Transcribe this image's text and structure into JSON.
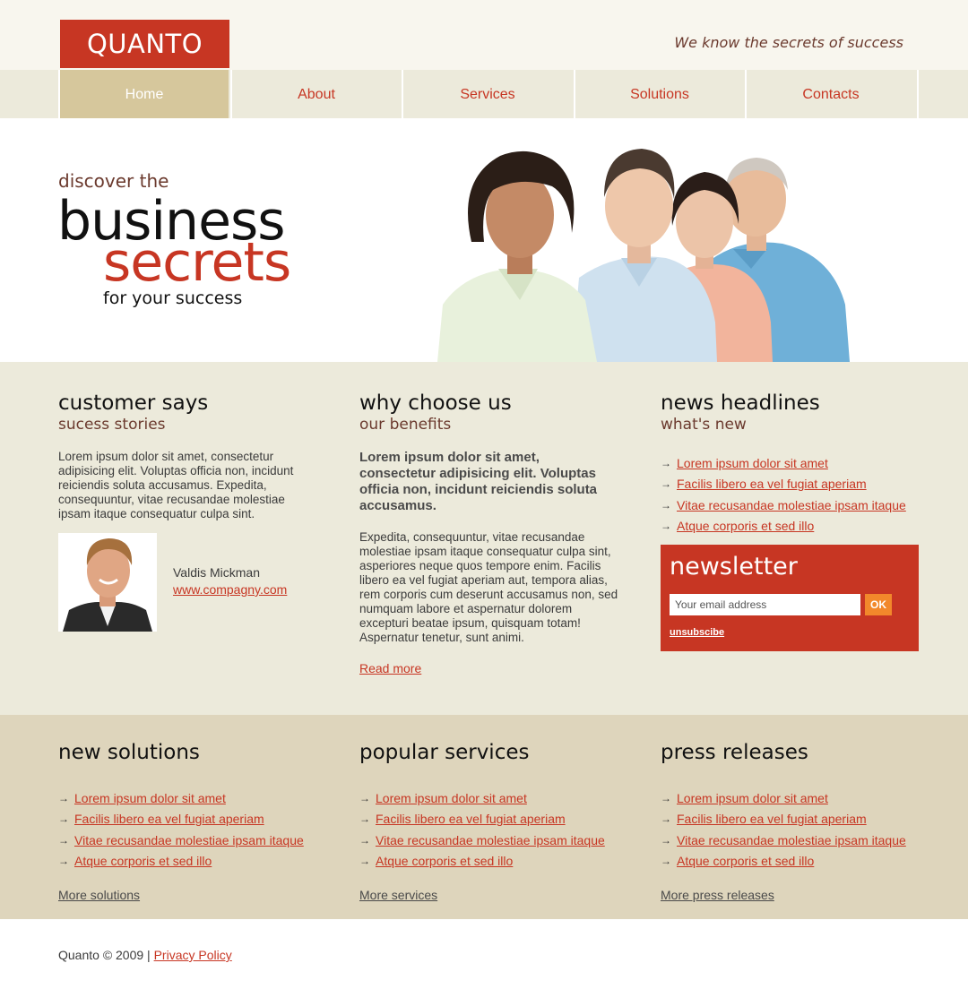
{
  "header": {
    "logo": "QUANTO",
    "tagline": "We know the secrets of success"
  },
  "nav": {
    "items": [
      {
        "label": "Home",
        "active": true
      },
      {
        "label": "About",
        "active": false
      },
      {
        "label": "Services",
        "active": false
      },
      {
        "label": "Solutions",
        "active": false
      },
      {
        "label": "Contacts",
        "active": false
      }
    ]
  },
  "hero": {
    "discover": "discover the",
    "business": "business",
    "secrets": "secrets",
    "success": "for your success"
  },
  "customer": {
    "title": "customer says",
    "subtitle": "sucess stories",
    "text": "Lorem ipsum dolor sit amet, consectetur adipisicing elit. Voluptas officia non, incidunt reiciendis soluta accusamus. Expedita, consequuntur, vitae recusandae molestiae ipsam itaque consequatur culpa sint.",
    "name": "Valdis Mickman",
    "website": "www.compagny.com"
  },
  "why": {
    "title": "why choose us",
    "subtitle": "our benefits",
    "bold_text": "Lorem ipsum dolor sit amet, consectetur adipisicing elit. Voluptas officia non, incidunt reiciendis soluta accusamus.",
    "text": "Expedita, consequuntur, vitae recusandae molestiae ipsam itaque consequatur culpa sint, asperiores neque quos tempore enim. Facilis libero ea vel fugiat aperiam aut, tempora alias, rem corporis cum deserunt accusamus non, sed numquam labore et aspernatur dolorem excepturi beatae ipsum, quisquam totam! Aspernatur tenetur, sunt animi.",
    "read_more": "Read more"
  },
  "news": {
    "title": "news headlines",
    "subtitle": "what's new",
    "links": [
      "Lorem ipsum dolor sit amet",
      "Facilis libero ea vel fugiat aperiam",
      "Vitae recusandae molestiae ipsam itaque",
      "Atque corporis et sed illo"
    ]
  },
  "newsletter": {
    "title": "newsletter",
    "placeholder": "Your email address",
    "ok": "OK",
    "unsubscribe": "unsubscibe"
  },
  "solutions": {
    "title": "new solutions",
    "links": [
      "Lorem ipsum dolor sit amet",
      "Facilis libero ea vel fugiat aperiam",
      "Vitae recusandae molestiae ipsam itaque",
      "Atque corporis et sed illo"
    ],
    "more": "More solutions"
  },
  "services": {
    "title": "popular services",
    "links": [
      "Lorem ipsum dolor sit amet",
      "Facilis libero ea vel fugiat aperiam",
      "Vitae recusandae molestiae ipsam itaque",
      "Atque corporis et sed illo"
    ],
    "more": "More services"
  },
  "press": {
    "title": "press releases",
    "links": [
      "Lorem ipsum dolor sit amet",
      "Facilis libero ea vel fugiat aperiam",
      "Vitae recusandae molestiae ipsam itaque",
      "Atque corporis et sed illo"
    ],
    "more": "More press releases"
  },
  "footer": {
    "copyright": "Quanto © 2009 |",
    "privacy": "Privacy Policy"
  },
  "colors": {
    "accent": "#c73623",
    "nav_bg": "#eceadb",
    "nav_active": "#d6c79c",
    "bottom_bg": "#ded5bc",
    "ok_button": "#f2882b"
  }
}
